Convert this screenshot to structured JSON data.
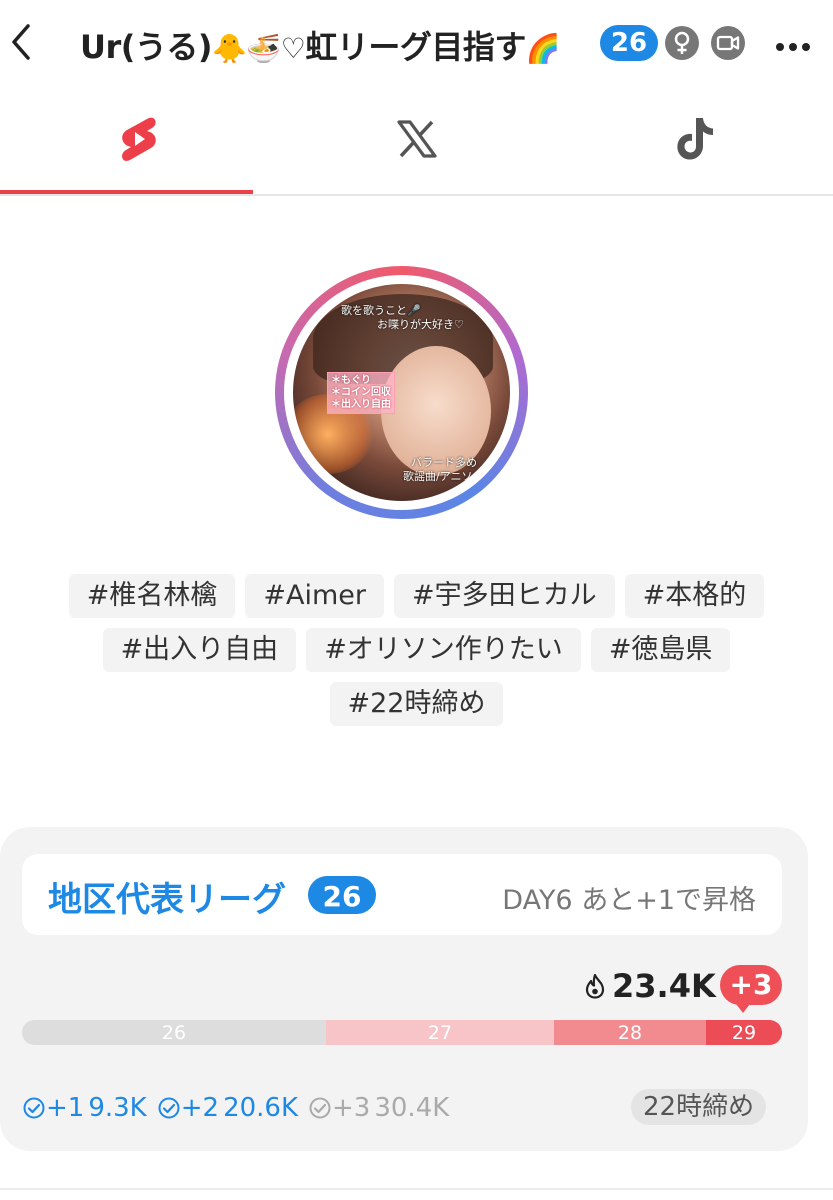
{
  "header": {
    "title_text": "Ur(うる)",
    "title_emojis": "🐥🍜♡",
    "title_suffix": "虹リーグ目指す",
    "title_end_emoji": "🌈",
    "level": "26",
    "icons": [
      "back-icon",
      "female-icon",
      "video-icon",
      "more-icon"
    ]
  },
  "tabs": [
    {
      "icon": "youtube-shorts-icon",
      "active": true
    },
    {
      "icon": "x-icon",
      "active": false
    },
    {
      "icon": "tiktok-icon",
      "active": false
    }
  ],
  "avatar": {
    "overlay_top": [
      "歌を歌うこと🎤",
      "お喋りが大好き♡"
    ],
    "overlay_box": [
      "＊もぐり",
      "＊コイン回収",
      "＊出入り自由"
    ],
    "overlay_bottom": [
      "バラード多め",
      "歌謡曲/アニソン/ボカ"
    ]
  },
  "tags": [
    [
      "#椎名林檎",
      "#Aimer",
      "#宇多田ヒカル",
      "#本格的"
    ],
    [
      "#出入り自由",
      "#オリソン作りたい",
      "#徳島県"
    ],
    [
      "#22時締め"
    ]
  ],
  "league": {
    "title": "地区代表リーグ",
    "rank": "26",
    "status": "DAY6 あと+1で昇格",
    "points": "23.4K",
    "delta": "+3",
    "bar": [
      {
        "label": "26",
        "share": 0.4,
        "color": "#dddddd"
      },
      {
        "label": "27",
        "share": 0.3,
        "color": "#f7c4c7"
      },
      {
        "label": "28",
        "share": 0.2,
        "color": "#f28b8f"
      },
      {
        "label": "29",
        "share": 0.1,
        "color": "#ec4c55"
      }
    ],
    "goals": [
      {
        "label": "+1",
        "value": "9.3K",
        "color": "#1e88e5"
      },
      {
        "label": "+2",
        "value": "20.6K",
        "color": "#1e88e5"
      },
      {
        "label": "+3",
        "value": "30.4K",
        "color": "#aaaaaa"
      }
    ],
    "deadline": "22時締め"
  }
}
